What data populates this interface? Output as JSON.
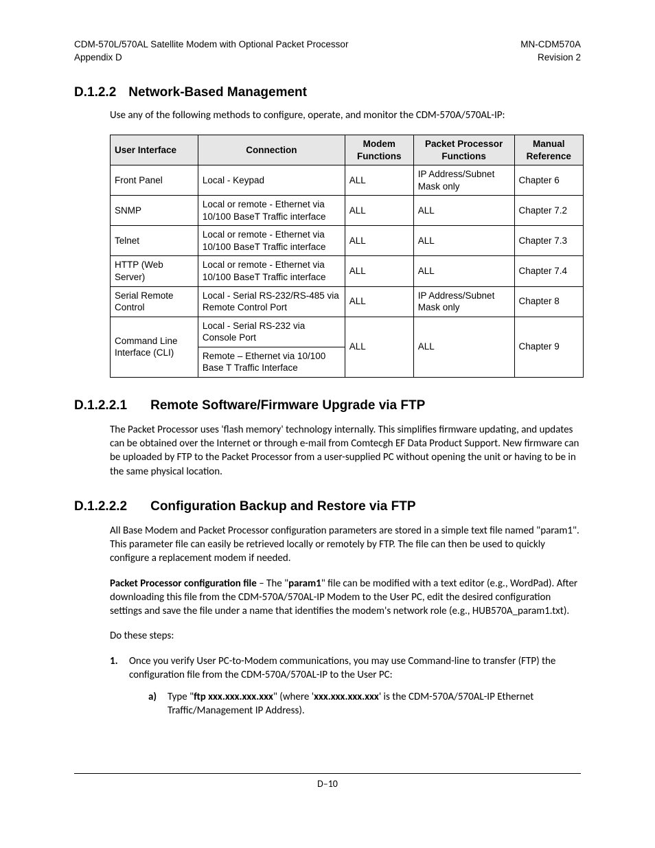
{
  "header": {
    "left_line1": "CDM-570L/570AL Satellite Modem with Optional Packet Processor",
    "left_line2": "Appendix D",
    "right_line1": "MN-CDM570A",
    "right_line2": "Revision 2"
  },
  "s1": {
    "num": "D.1.2.2",
    "title": "Network-Based Management",
    "intro": "Use any of the following methods to configure, operate, and monitor the CDM-570A/570AL-IP:"
  },
  "table": {
    "head": {
      "c1": "User Interface",
      "c2": "Connection",
      "c3": "Modem Functions",
      "c4": "Packet Processor Functions",
      "c5": "Manual Reference"
    },
    "rows": [
      {
        "c1": "Front Panel",
        "c2": "Local - Keypad",
        "c3": "ALL",
        "c4": "IP Address/Subnet Mask only",
        "c5": "Chapter 6"
      },
      {
        "c1": "SNMP",
        "c2": "Local or remote - Ethernet via 10/100 BaseT Traffic interface",
        "c3": "ALL",
        "c4": "ALL",
        "c5": "Chapter 7.2"
      },
      {
        "c1": "Telnet",
        "c2": "Local or remote - Ethernet via 10/100 BaseT Traffic interface",
        "c3": "ALL",
        "c4": "ALL",
        "c5": "Chapter 7.3"
      },
      {
        "c1": "HTTP (Web Server)",
        "c2": "Local or remote - Ethernet via 10/100 BaseT Traffic interface",
        "c3": "ALL",
        "c4": "ALL",
        "c5": "Chapter 7.4"
      },
      {
        "c1": "Serial Remote Control",
        "c2": "Local - Serial RS-232/RS-485 via Remote Control Port",
        "c3": "ALL",
        "c4": "IP Address/Subnet Mask only",
        "c5": "Chapter 8"
      }
    ],
    "row6": {
      "c1": "Command Line Interface (CLI)",
      "c2a": "Local - Serial RS-232 via Console Port",
      "c2b": "Remote – Ethernet  via 10/100 Base T Traffic Interface",
      "c3": "ALL",
      "c4": "ALL",
      "c5": "Chapter 9"
    }
  },
  "s2": {
    "num": "D.1.2.2.1",
    "title": "Remote Software/Firmware Upgrade via FTP",
    "p1": "The Packet Processor uses 'flash memory' technology internally. This simplifies firmware updating, and updates can be obtained over the Internet or through e-mail from Comtecgh EF Data Product Support. New firmware can be uploaded by FTP to the Packet Processor from a user-supplied PC without opening the unit or having to be in the same physical location."
  },
  "s3": {
    "num": "D.1.2.2.2",
    "title": "Configuration Backup and Restore via FTP",
    "p1": "All Base Modem and Packet Processor configuration parameters are stored in a simple text file named \"param1\". This parameter file can easily be retrieved locally or remotely by FTP. The file can then be used to quickly configure a replacement modem if needed.",
    "p2_lead": "Packet Processor configuration file",
    "p2_mid1": " – The \"",
    "p2_bold": "param1",
    "p2_mid2": "\" file can be modified with a text editor (e.g., WordPad). After downloading this file from the CDM-570A/570AL-IP Modem to the User PC, edit the desired configuration settings and save the file under a name that identifies the modem's network role (e.g., HUB570A_param1.txt).",
    "p3": "Do these steps:",
    "step1_marker": "1.",
    "step1_text": "Once you verify User PC-to-Modem communications, you may use Command-line to transfer (FTP) the configuration file from the CDM-570A/570AL-IP to the User PC:",
    "step1a_marker": "a)",
    "step1a_pre": "Type \"",
    "step1a_b1": "ftp xxx.xxx.xxx.xxx",
    "step1a_mid": "\" (where '",
    "step1a_b2": "xxx.xxx.xxx.xxx",
    "step1a_post": "' is the CDM-570A/570AL-IP Ethernet Traffic/Management IP Address)."
  },
  "footer": {
    "page": "D–10"
  }
}
